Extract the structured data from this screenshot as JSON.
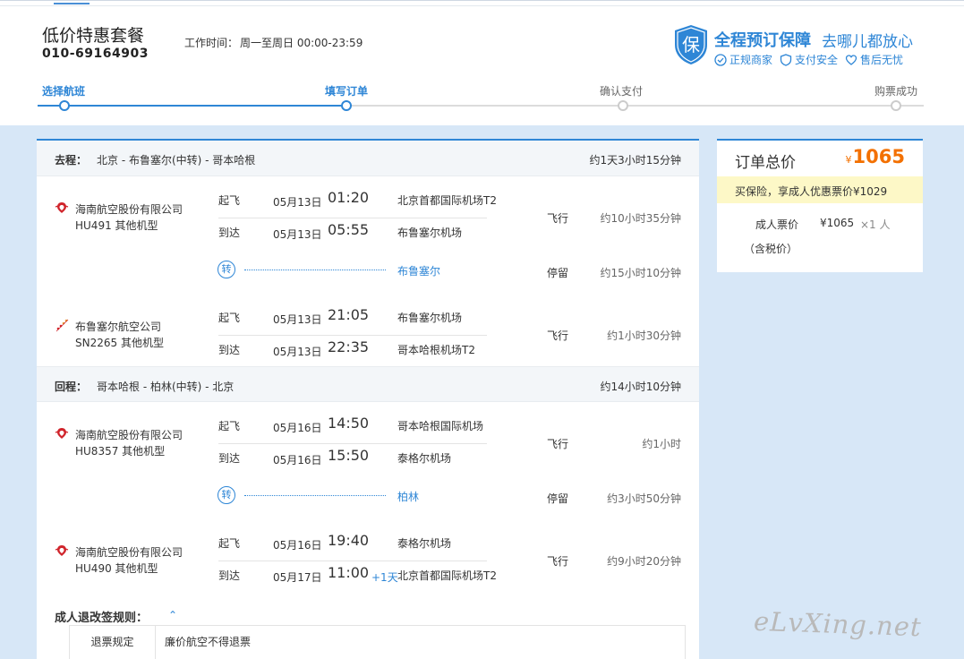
{
  "header": {
    "title": "低价特惠套餐",
    "phone": "010-69164903",
    "worktime_label": "工作时间：",
    "worktime_value": "周一至周日 00:00-23:59"
  },
  "guarantee": {
    "badge": "保",
    "title": "全程预订保障",
    "slogan": "去哪儿都放心",
    "features": [
      "正规商家",
      "支付安全",
      "售后无忧"
    ]
  },
  "steps": [
    "选择航班",
    "填写订单",
    "确认支付",
    "购票成功"
  ],
  "outbound": {
    "label": "去程：",
    "route": "北京 - 布鲁塞尔(中转) - 哥本哈根",
    "total": "约1天3小时15分钟",
    "flights": [
      {
        "airline": "海南航空股份有限公司",
        "flight_no": "HU491 其他机型",
        "dep_kind": "起飞",
        "dep_date": "05月13日",
        "dep_time": "01:20",
        "dep_airport": "北京首都国际机场T2",
        "arr_kind": "到达",
        "arr_date": "05月13日",
        "arr_time": "05:55",
        "arr_airport": "布鲁塞尔机场",
        "plusday": "",
        "fly_label": "飞行",
        "duration": "约10小时35分钟"
      },
      {
        "airline": "布鲁塞尔航空公司",
        "flight_no": "SN2265 其他机型",
        "dep_kind": "起飞",
        "dep_date": "05月13日",
        "dep_time": "21:05",
        "dep_airport": "布鲁塞尔机场",
        "arr_kind": "到达",
        "arr_date": "05月13日",
        "arr_time": "22:35",
        "arr_airport": "哥本哈根机场T2",
        "plusday": "",
        "fly_label": "飞行",
        "duration": "约1小时30分钟"
      }
    ],
    "transfer": {
      "icon": "转",
      "city": "布鲁塞尔",
      "label": "停留",
      "duration": "约15小时10分钟"
    }
  },
  "inbound": {
    "label": "回程：",
    "route": "哥本哈根 - 柏林(中转) - 北京",
    "total": "约14小时10分钟",
    "flights": [
      {
        "airline": "海南航空股份有限公司",
        "flight_no": "HU8357 其他机型",
        "dep_kind": "起飞",
        "dep_date": "05月16日",
        "dep_time": "14:50",
        "dep_airport": "哥本哈根国际机场",
        "arr_kind": "到达",
        "arr_date": "05月16日",
        "arr_time": "15:50",
        "arr_airport": "泰格尔机场",
        "plusday": "",
        "fly_label": "飞行",
        "duration": "约1小时"
      },
      {
        "airline": "海南航空股份有限公司",
        "flight_no": "HU490 其他机型",
        "dep_kind": "起飞",
        "dep_date": "05月16日",
        "dep_time": "19:40",
        "dep_airport": "泰格尔机场",
        "arr_kind": "到达",
        "arr_date": "05月17日",
        "arr_time": "11:00",
        "arr_airport": "北京首都国际机场T2",
        "plusday": "+1天",
        "fly_label": "飞行",
        "duration": "约9小时20分钟"
      }
    ],
    "transfer": {
      "icon": "转",
      "city": "柏林",
      "label": "停留",
      "duration": "约3小时50分钟"
    }
  },
  "rules": {
    "title": "成人退改签规则：",
    "toggle": "⌃",
    "rows": [
      {
        "name": "退票规定",
        "value": "廉价航空不得退票"
      }
    ]
  },
  "order": {
    "title": "订单总价",
    "currency": "¥",
    "total": "1065",
    "promo": "买保险，享成人优惠票价¥1029",
    "fare_label": "成人票价",
    "fare_price": "¥1065",
    "fare_count": "×1 人",
    "tax_note": "（含税价）"
  },
  "watermark": "eLvXing.net",
  "colors": {
    "accent": "#2e86d6",
    "price": "#f37000",
    "promo_bg": "#fdf8c7",
    "page_bg": "#d7e7f7",
    "hainan_red": "#d0242b"
  }
}
